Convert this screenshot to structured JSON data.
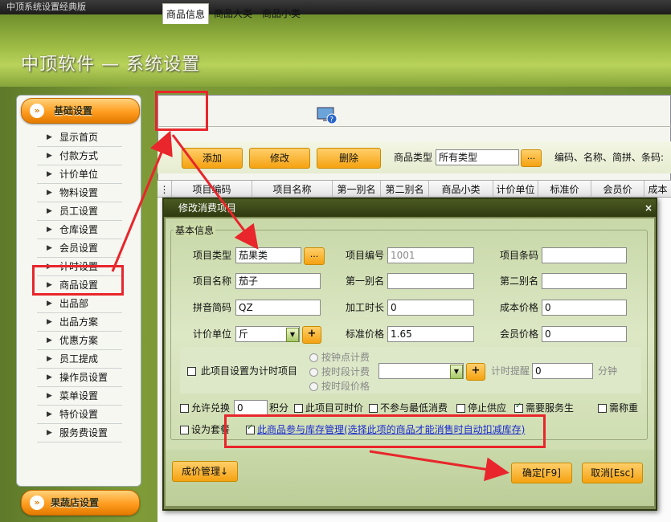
{
  "window": {
    "title": "中顶系统设置经典版"
  },
  "header": {
    "title": "中顶软件 — 系统设置"
  },
  "sidebar": {
    "section_title": "基础设置",
    "items": [
      {
        "label": "显示首页"
      },
      {
        "label": "付款方式"
      },
      {
        "label": "计价单位"
      },
      {
        "label": "物料设置"
      },
      {
        "label": "员工设置"
      },
      {
        "label": "仓库设置"
      },
      {
        "label": "会员设置"
      },
      {
        "label": "计时设置"
      },
      {
        "label": "商品设置"
      },
      {
        "label": "出品部"
      },
      {
        "label": "出品方案"
      },
      {
        "label": "优惠方案"
      },
      {
        "label": "员工提成"
      },
      {
        "label": "操作员设置"
      },
      {
        "label": "菜单设置"
      },
      {
        "label": "特价设置"
      },
      {
        "label": "服务费设置"
      }
    ],
    "bottom_section_title": "果蔬店设置"
  },
  "tabs": [
    {
      "label": "商品信息",
      "active": true
    },
    {
      "label": "商品大类"
    },
    {
      "label": "商品小类"
    }
  ],
  "toolbar": {
    "add_label": "添加",
    "edit_label": "修改",
    "delete_label": "删除",
    "type_label": "商品类型",
    "type_value": "所有类型",
    "ellipsis": "...",
    "search_label": "编码、名称、简拼、条码:"
  },
  "grid": {
    "columns": [
      "项目编码",
      "项目名称",
      "第一别名",
      "第二别名",
      "商品小类",
      "计价单位",
      "标准价",
      "会员价",
      "成本"
    ]
  },
  "dialog": {
    "title": "修改消费项目",
    "close": "×",
    "group_title": "基本信息",
    "fields": {
      "item_type_label": "项目类型",
      "item_type_value": "茄果类",
      "item_code_label": "项目编号",
      "item_code_value": "1001",
      "barcode_label": "项目条码",
      "barcode_value": "",
      "item_name_label": "项目名称",
      "item_name_value": "茄子",
      "alias1_label": "第一别名",
      "alias1_value": "",
      "alias2_label": "第二别名",
      "alias2_value": "",
      "pinyin_label": "拼音简码",
      "pinyin_value": "QZ",
      "proc_time_label": "加工时长",
      "proc_time_value": "0",
      "cost_label": "成本价格",
      "cost_value": "0",
      "unit_label": "计价单位",
      "unit_value": "斤",
      "std_price_label": "标准价格",
      "std_price_value": "1.65",
      "member_price_label": "会员价格",
      "member_price_value": "0"
    },
    "timed": {
      "checkbox_label": "此项目设置为计时项目",
      "radio_point": "按钟点计费",
      "radio_period": "按时段计费",
      "radio_period_price": "按时段价格",
      "reminder_label": "计时提醒",
      "reminder_value": "0",
      "minutes_label": "分钟"
    },
    "options": {
      "allow_exchange": "允许兑换",
      "exchange_value": "0",
      "points": "积分",
      "item_timed": "此项目可时价",
      "no_min_spend": "不参与最低消费",
      "stop_supply": "停止供应",
      "need_service": "需要服务生",
      "need_weigh": "需称重",
      "set_package": "设为套餐",
      "inventory_link": "此商品参与库存管理(选择此项的商品才能消售时自动扣减库存)"
    },
    "cost_mgmt_button": "成价管理↓",
    "ok_button": "确定[F9]",
    "cancel_button": "取消[Esc]"
  },
  "colors": {
    "accent_orange": "#f5a211",
    "annotation_red": "#e8262b",
    "dialog_title_bg": "#2f3a10"
  }
}
